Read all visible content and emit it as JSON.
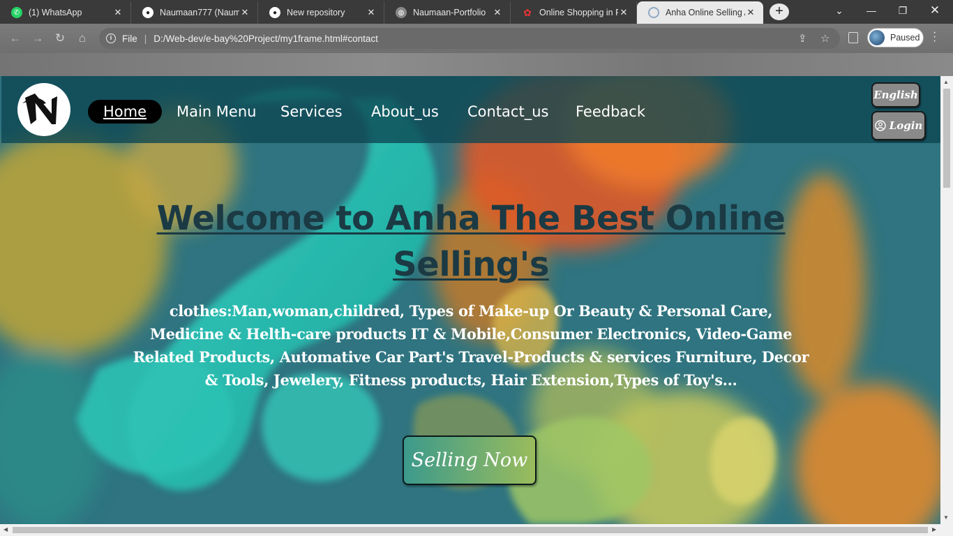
{
  "browser": {
    "tabs": [
      {
        "title": "(1) WhatsApp",
        "icon": "whatsapp-icon",
        "color": "#25d366"
      },
      {
        "title": "Naumaan777 (Naum",
        "icon": "github-icon",
        "color": "#ffffff"
      },
      {
        "title": "New repository",
        "icon": "github-icon",
        "color": "#ffffff"
      },
      {
        "title": "Naumaan-Portfolio",
        "icon": "globe-icon",
        "color": "#9a9a9a"
      },
      {
        "title": "Online Shopping in P",
        "icon": "shop-icon",
        "color": "#e33"
      },
      {
        "title": "Anha Online Selling A",
        "icon": "loading-icon",
        "color": "#8fa9c4"
      }
    ],
    "new_tab": "+",
    "address": {
      "scheme": "File",
      "url": "D:/Web-dev/e-bay%20Project/my1frame.html#contact"
    },
    "profile_status": "Paused"
  },
  "site": {
    "nav": {
      "home": "Home",
      "main_menu": "Main Menu",
      "services": "Services",
      "about": "About_us",
      "contact": "Contact_us",
      "feedback": "Feedback"
    },
    "language_button": "English",
    "login_button": "Login",
    "headline": "Welcome to Anha The Best Online Selling's",
    "description": "clothes:Man,woman,childred, Types of Make-up Or Beauty & Personal Care, Medicine & Helth-care products IT & Mobile,Consumer Electronics, Video-Game Related Products, Automative Car Part's Travel-Products & services Furniture, Decor & Tools, Jewelery, Fitness products, Hair Extension,Types of Toy's...",
    "cta": "Selling Now"
  },
  "colors": {
    "nav_overlay": "#0d4652",
    "headline": "#1b3a44",
    "cta_gradient_start": "#3c9a8c",
    "cta_gradient_end": "#9abc5c",
    "page_bg": "#2a6f7a"
  }
}
